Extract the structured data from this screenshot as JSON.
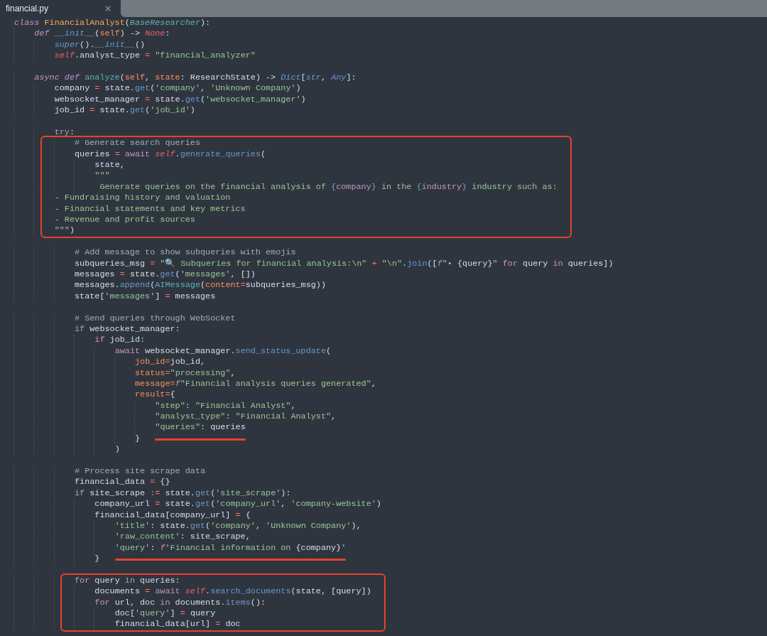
{
  "tab": {
    "title": "financial.py"
  },
  "blocks": [
    {
      "segments": [
        {
          "kind": "plain",
          "lines": [
            {
              "tokens": [
                {
                  "kind": "kw",
                  "text": "class"
                },
                {
                  "kind": "cls",
                  "text": " FinancialAnalyst"
                },
                {
                  "kind": "p",
                  "text": "("
                },
                {
                  "kind": "base",
                  "text": "BaseResearcher"
                },
                {
                  "kind": "p",
                  "text": "):"
                }
              ]
            },
            {
              "tokens": [
                {
                  "kind": "kw",
                  "text": "    def"
                },
                {
                  "kind": "mag",
                  "text": " __init__"
                },
                {
                  "kind": "p",
                  "text": "("
                },
                {
                  "kind": "prm",
                  "text": "self"
                },
                {
                  "kind": "p",
                  "text": ") -> "
                },
                {
                  "kind": "slf",
                  "text": "None"
                },
                {
                  "kind": "p",
                  "text": ":"
                }
              ]
            },
            {
              "tokens": [
                {
                  "kind": "mag",
                  "text": "        super"
                },
                {
                  "kind": "p",
                  "text": "()."
                },
                {
                  "kind": "mag",
                  "text": "__init__"
                },
                {
                  "kind": "p",
                  "text": "()"
                }
              ]
            },
            {
              "tokens": [
                {
                  "kind": "slf",
                  "text": "        self"
                },
                {
                  "kind": "p",
                  "text": ".analyst_type "
                },
                {
                  "kind": "op",
                  "text": "="
                },
                {
                  "kind": "str",
                  "text": " \"financial_analyzer\""
                }
              ]
            }
          ]
        }
      ]
    },
    {
      "segments": [
        {
          "kind": "plain",
          "lines": [
            {
              "tokens": [
                {
                  "kind": "kw",
                  "text": "    async def"
                },
                {
                  "kind": "teal",
                  "text": " analyze"
                },
                {
                  "kind": "p",
                  "text": "("
                },
                {
                  "kind": "prm",
                  "text": "self"
                },
                {
                  "kind": "p",
                  "text": ", "
                },
                {
                  "kind": "prm",
                  "text": "state"
                },
                {
                  "kind": "p",
                  "text": ": ResearchState) -> "
                },
                {
                  "kind": "mag",
                  "text": "Dict"
                },
                {
                  "kind": "p",
                  "text": "["
                },
                {
                  "kind": "mag",
                  "text": "str"
                },
                {
                  "kind": "p",
                  "text": ", "
                },
                {
                  "kind": "mag",
                  "text": "Any"
                },
                {
                  "kind": "p",
                  "text": "]:"
                }
              ]
            },
            {
              "tokens": [
                {
                  "kind": "p",
                  "text": "        company "
                },
                {
                  "kind": "op",
                  "text": "="
                },
                {
                  "kind": "p",
                  "text": " state."
                },
                {
                  "kind": "fn",
                  "text": "get"
                },
                {
                  "kind": "p",
                  "text": "("
                },
                {
                  "kind": "str",
                  "text": "'company'"
                },
                {
                  "kind": "p",
                  "text": ", "
                },
                {
                  "kind": "str",
                  "text": "'Unknown Company'"
                },
                {
                  "kind": "p",
                  "text": ")"
                }
              ]
            },
            {
              "tokens": [
                {
                  "kind": "p",
                  "text": "        websocket_manager "
                },
                {
                  "kind": "op",
                  "text": "="
                },
                {
                  "kind": "p",
                  "text": " state."
                },
                {
                  "kind": "fn",
                  "text": "get"
                },
                {
                  "kind": "p",
                  "text": "("
                },
                {
                  "kind": "str",
                  "text": "'websocket_manager'"
                },
                {
                  "kind": "p",
                  "text": ")"
                }
              ]
            },
            {
              "tokens": [
                {
                  "kind": "p",
                  "text": "        job_id "
                },
                {
                  "kind": "op",
                  "text": "="
                },
                {
                  "kind": "p",
                  "text": " state."
                },
                {
                  "kind": "fn",
                  "text": "get"
                },
                {
                  "kind": "p",
                  "text": "("
                },
                {
                  "kind": "str",
                  "text": "'job_id'"
                },
                {
                  "kind": "p",
                  "text": ")"
                }
              ]
            }
          ]
        }
      ]
    },
    {
      "segments": [
        {
          "kind": "plain",
          "lines": [
            {
              "tokens": [
                {
                  "kind": "ctl",
                  "text": "        try"
                },
                {
                  "kind": "p",
                  "text": ":"
                }
              ]
            }
          ]
        },
        {
          "kind": "boxed",
          "lines": [
            {
              "tokens": [
                {
                  "kind": "com",
                  "text": "            # Generate search queries"
                }
              ]
            },
            {
              "tokens": [
                {
                  "kind": "p",
                  "text": "            queries "
                },
                {
                  "kind": "op",
                  "text": "="
                },
                {
                  "kind": "ctl",
                  "text": " await "
                },
                {
                  "kind": "slf",
                  "text": "self"
                },
                {
                  "kind": "p",
                  "text": "."
                },
                {
                  "kind": "fn",
                  "text": "generate_queries"
                },
                {
                  "kind": "p",
                  "text": "("
                }
              ]
            },
            {
              "tokens": [
                {
                  "kind": "p",
                  "text": "                state,"
                }
              ]
            },
            {
              "tokens": [
                {
                  "kind": "str",
                  "text": "                \"\"\""
                }
              ]
            },
            {
              "tokens": [
                {
                  "kind": "str",
                  "text": "                 Generate queries on the financial analysis of "
                },
                {
                  "kind": "teal",
                  "text": "{"
                },
                {
                  "kind": "itp",
                  "text": "company"
                },
                {
                  "kind": "teal",
                  "text": "}"
                },
                {
                  "kind": "str",
                  "text": " in the "
                },
                {
                  "kind": "teal",
                  "text": "{"
                },
                {
                  "kind": "itp",
                  "text": "industry"
                },
                {
                  "kind": "teal",
                  "text": "}"
                },
                {
                  "kind": "str",
                  "text": " industry such as:"
                }
              ]
            },
            {
              "tokens": [
                {
                  "kind": "str",
                  "text": "        - Fundraising history and valuation"
                }
              ]
            },
            {
              "tokens": [
                {
                  "kind": "str",
                  "text": "        - Financial statements and key metrics"
                }
              ]
            },
            {
              "tokens": [
                {
                  "kind": "str",
                  "text": "        - Revenue and profit sources"
                }
              ]
            },
            {
              "tokens": [
                {
                  "kind": "str",
                  "text": "        \"\"\""
                },
                {
                  "kind": "p",
                  "text": ")"
                }
              ]
            }
          ]
        }
      ]
    },
    {
      "segments": [
        {
          "kind": "plain",
          "lines": [
            {
              "tokens": [
                {
                  "kind": "com",
                  "text": "            # Add message to show subqueries with emojis"
                }
              ]
            },
            {
              "tokens": [
                {
                  "kind": "p",
                  "text": "            subqueries_msg "
                },
                {
                  "kind": "op",
                  "text": "="
                },
                {
                  "kind": "str",
                  "text": " \"🔍 Subqueries for financial analysis:\\n\" "
                },
                {
                  "kind": "op",
                  "text": "+"
                },
                {
                  "kind": "str",
                  "text": " \"\\n\""
                },
                {
                  "kind": "p",
                  "text": "."
                },
                {
                  "kind": "fn",
                  "text": "join"
                },
                {
                  "kind": "p",
                  "text": "(["
                },
                {
                  "kind": "fpre",
                  "text": "f"
                },
                {
                  "kind": "str",
                  "text": "\"• "
                },
                {
                  "kind": "p",
                  "text": "{query}"
                },
                {
                  "kind": "str",
                  "text": "\""
                },
                {
                  "kind": "ctl",
                  "text": " for"
                },
                {
                  "kind": "p",
                  "text": " query "
                },
                {
                  "kind": "ctl",
                  "text": "in"
                },
                {
                  "kind": "p",
                  "text": " queries])"
                }
              ]
            },
            {
              "tokens": [
                {
                  "kind": "p",
                  "text": "            messages "
                },
                {
                  "kind": "op",
                  "text": "="
                },
                {
                  "kind": "p",
                  "text": " state."
                },
                {
                  "kind": "fn",
                  "text": "get"
                },
                {
                  "kind": "p",
                  "text": "("
                },
                {
                  "kind": "str",
                  "text": "'messages'"
                },
                {
                  "kind": "p",
                  "text": ", [])"
                }
              ]
            },
            {
              "tokens": [
                {
                  "kind": "p",
                  "text": "            messages."
                },
                {
                  "kind": "fn",
                  "text": "append"
                },
                {
                  "kind": "p",
                  "text": "("
                },
                {
                  "kind": "teal",
                  "text": "AIMessage"
                },
                {
                  "kind": "p",
                  "text": "("
                },
                {
                  "kind": "prm",
                  "text": "content"
                },
                {
                  "kind": "op",
                  "text": "="
                },
                {
                  "kind": "p",
                  "text": "subqueries_msg))"
                }
              ]
            },
            {
              "tokens": [
                {
                  "kind": "p",
                  "text": "            state["
                },
                {
                  "kind": "str",
                  "text": "'messages'"
                },
                {
                  "kind": "p",
                  "text": "] "
                },
                {
                  "kind": "op",
                  "text": "="
                },
                {
                  "kind": "p",
                  "text": " messages"
                }
              ]
            }
          ]
        }
      ]
    },
    {
      "segments": [
        {
          "kind": "plain",
          "lines": [
            {
              "tokens": [
                {
                  "kind": "com",
                  "text": "            # Send queries through WebSocket"
                }
              ]
            },
            {
              "tokens": [
                {
                  "kind": "ctl",
                  "text": "            if"
                },
                {
                  "kind": "p",
                  "text": " websocket_manager:"
                }
              ]
            },
            {
              "tokens": [
                {
                  "kind": "ctl",
                  "text": "                if"
                },
                {
                  "kind": "p",
                  "text": " job_id:"
                }
              ]
            },
            {
              "tokens": [
                {
                  "kind": "ctl",
                  "text": "                    await"
                },
                {
                  "kind": "p",
                  "text": " websocket_manager."
                },
                {
                  "kind": "fn",
                  "text": "send_status_update"
                },
                {
                  "kind": "p",
                  "text": "("
                }
              ]
            },
            {
              "tokens": [
                {
                  "kind": "prm",
                  "text": "                        job_id"
                },
                {
                  "kind": "op",
                  "text": "="
                },
                {
                  "kind": "p",
                  "text": "job_id,"
                }
              ]
            },
            {
              "tokens": [
                {
                  "kind": "prm",
                  "text": "                        status"
                },
                {
                  "kind": "op",
                  "text": "="
                },
                {
                  "kind": "str",
                  "text": "\"processing\""
                },
                {
                  "kind": "p",
                  "text": ","
                }
              ]
            },
            {
              "tokens": [
                {
                  "kind": "prm",
                  "text": "                        message"
                },
                {
                  "kind": "op",
                  "text": "="
                },
                {
                  "kind": "fpre",
                  "text": "f"
                },
                {
                  "kind": "str",
                  "text": "\"Financial analysis queries generated\""
                },
                {
                  "kind": "p",
                  "text": ","
                }
              ]
            },
            {
              "tokens": [
                {
                  "kind": "prm",
                  "text": "                        result"
                },
                {
                  "kind": "op",
                  "text": "="
                },
                {
                  "kind": "p",
                  "text": "{"
                }
              ]
            },
            {
              "tokens": [
                {
                  "kind": "str",
                  "text": "                            \"step\""
                },
                {
                  "kind": "p",
                  "text": ": "
                },
                {
                  "kind": "str",
                  "text": "\"Financial Analyst\""
                },
                {
                  "kind": "p",
                  "text": ","
                }
              ]
            },
            {
              "tokens": [
                {
                  "kind": "str",
                  "text": "                            \"analyst_type\""
                },
                {
                  "kind": "p",
                  "text": ": "
                },
                {
                  "kind": "str",
                  "text": "\"Financial Analyst\""
                },
                {
                  "kind": "p",
                  "text": ","
                }
              ]
            }
          ]
        },
        {
          "kind": "underlined",
          "lines": [
            {
              "tokens": [
                {
                  "kind": "str",
                  "text": "                            \"queries\""
                },
                {
                  "kind": "p",
                  "text": ": queries"
                }
              ]
            }
          ]
        },
        {
          "kind": "plain",
          "lines": [
            {
              "tokens": [
                {
                  "kind": "p",
                  "text": "                        }"
                }
              ]
            },
            {
              "tokens": [
                {
                  "kind": "p",
                  "text": "                    )"
                }
              ]
            }
          ]
        }
      ]
    },
    {
      "segments": [
        {
          "kind": "plain",
          "lines": [
            {
              "tokens": [
                {
                  "kind": "com",
                  "text": "            # Process site scrape data"
                }
              ]
            },
            {
              "tokens": [
                {
                  "kind": "p",
                  "text": "            financial_data "
                },
                {
                  "kind": "op",
                  "text": "="
                },
                {
                  "kind": "p",
                  "text": " {}"
                }
              ]
            },
            {
              "tokens": [
                {
                  "kind": "ctl",
                  "text": "            if"
                },
                {
                  "kind": "p",
                  "text": " site_scrape "
                },
                {
                  "kind": "op",
                  "text": ":="
                },
                {
                  "kind": "p",
                  "text": " state."
                },
                {
                  "kind": "fn",
                  "text": "get"
                },
                {
                  "kind": "p",
                  "text": "("
                },
                {
                  "kind": "str",
                  "text": "'site_scrape'"
                },
                {
                  "kind": "p",
                  "text": "):"
                }
              ]
            },
            {
              "tokens": [
                {
                  "kind": "p",
                  "text": "                company_url "
                },
                {
                  "kind": "op",
                  "text": "="
                },
                {
                  "kind": "p",
                  "text": " state."
                },
                {
                  "kind": "fn",
                  "text": "get"
                },
                {
                  "kind": "p",
                  "text": "("
                },
                {
                  "kind": "str",
                  "text": "'company_url'"
                },
                {
                  "kind": "p",
                  "text": ", "
                },
                {
                  "kind": "str",
                  "text": "'company-website'"
                },
                {
                  "kind": "p",
                  "text": ")"
                }
              ]
            },
            {
              "tokens": [
                {
                  "kind": "p",
                  "text": "                financial_data[company_url] "
                },
                {
                  "kind": "op",
                  "text": "="
                },
                {
                  "kind": "p",
                  "text": " {"
                }
              ]
            },
            {
              "tokens": [
                {
                  "kind": "str",
                  "text": "                    'title'"
                },
                {
                  "kind": "p",
                  "text": ": state."
                },
                {
                  "kind": "fn",
                  "text": "get"
                },
                {
                  "kind": "p",
                  "text": "("
                },
                {
                  "kind": "str",
                  "text": "'company'"
                },
                {
                  "kind": "p",
                  "text": ", "
                },
                {
                  "kind": "str",
                  "text": "'Unknown Company'"
                },
                {
                  "kind": "p",
                  "text": "),"
                }
              ]
            },
            {
              "tokens": [
                {
                  "kind": "str",
                  "text": "                    'raw_content'"
                },
                {
                  "kind": "p",
                  "text": ": site_scrape,"
                }
              ]
            }
          ]
        },
        {
          "kind": "underlined",
          "lines": [
            {
              "tokens": [
                {
                  "kind": "str",
                  "text": "                    'query'"
                },
                {
                  "kind": "p",
                  "text": ": "
                },
                {
                  "kind": "fpre",
                  "text": "f"
                },
                {
                  "kind": "str",
                  "text": "'Financial information on "
                },
                {
                  "kind": "p",
                  "text": "{company}"
                },
                {
                  "kind": "str",
                  "text": "'"
                }
              ]
            }
          ]
        },
        {
          "kind": "plain",
          "lines": [
            {
              "tokens": [
                {
                  "kind": "p",
                  "text": "                }"
                }
              ]
            }
          ]
        }
      ]
    },
    {
      "segments": [
        {
          "kind": "boxed",
          "lines": [
            {
              "tokens": [
                {
                  "kind": "ctl",
                  "text": "            for"
                },
                {
                  "kind": "p",
                  "text": " query "
                },
                {
                  "kind": "ctl",
                  "text": "in"
                },
                {
                  "kind": "p",
                  "text": " queries:"
                }
              ]
            },
            {
              "tokens": [
                {
                  "kind": "p",
                  "text": "                documents "
                },
                {
                  "kind": "op",
                  "text": "="
                },
                {
                  "kind": "ctl",
                  "text": " await "
                },
                {
                  "kind": "slf",
                  "text": "self"
                },
                {
                  "kind": "p",
                  "text": "."
                },
                {
                  "kind": "fn",
                  "text": "search_documents"
                },
                {
                  "kind": "p",
                  "text": "(state, [query])"
                }
              ]
            },
            {
              "tokens": [
                {
                  "kind": "ctl",
                  "text": "                for"
                },
                {
                  "kind": "p",
                  "text": " url, doc "
                },
                {
                  "kind": "ctl",
                  "text": "in"
                },
                {
                  "kind": "p",
                  "text": " documents."
                },
                {
                  "kind": "fn",
                  "text": "items"
                },
                {
                  "kind": "p",
                  "text": "():"
                }
              ]
            },
            {
              "tokens": [
                {
                  "kind": "p",
                  "text": "                    doc["
                },
                {
                  "kind": "str",
                  "text": "'query'"
                },
                {
                  "kind": "p",
                  "text": "] "
                },
                {
                  "kind": "op",
                  "text": "="
                },
                {
                  "kind": "p",
                  "text": " query"
                }
              ]
            },
            {
              "tokens": [
                {
                  "kind": "p",
                  "text": "                    financial_data[url] "
                },
                {
                  "kind": "op",
                  "text": "="
                },
                {
                  "kind": "p",
                  "text": " doc"
                }
              ]
            }
          ]
        }
      ]
    }
  ]
}
